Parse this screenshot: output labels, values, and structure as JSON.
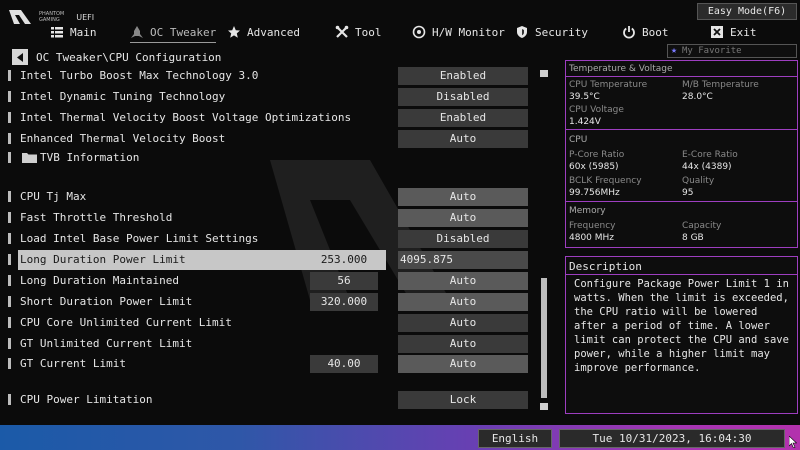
{
  "header": {
    "brand_line1": "PHANTOM",
    "brand_line2": "GAMING",
    "brand_uefi": "UEFI",
    "easy_mode_label": "Easy Mode(F6)",
    "tabs": [
      {
        "label": "Main",
        "icon": "list-icon"
      },
      {
        "label": "OC Tweaker",
        "icon": "rocket-icon",
        "active": true
      },
      {
        "label": "Advanced",
        "icon": "star-icon"
      },
      {
        "label": "Tool",
        "icon": "tools-icon"
      },
      {
        "label": "H/W Monitor",
        "icon": "monitor-icon"
      },
      {
        "label": "Security",
        "icon": "shield-icon"
      },
      {
        "label": "Boot",
        "icon": "power-icon"
      },
      {
        "label": "Exit",
        "icon": "exit-icon"
      }
    ]
  },
  "breadcrumb": "OC Tweaker\\CPU Configuration",
  "favorite_label": "My Favorite",
  "settings": [
    {
      "label": "Intel Turbo Boost Max Technology 3.0",
      "value": "Enabled"
    },
    {
      "label": "Intel Dynamic Tuning Technology",
      "value": "Disabled"
    },
    {
      "label": "Intel Thermal Velocity Boost Voltage Optimizations",
      "value": "Enabled"
    },
    {
      "label": "Enhanced Thermal Velocity Boost",
      "value": "Auto"
    },
    {
      "label": "TVB Information"
    },
    {
      "label": "CPU Tj Max",
      "value": "Auto"
    },
    {
      "label": "Fast Throttle Threshold",
      "value": "Auto"
    },
    {
      "label": "Load Intel Base Power Limit Settings",
      "value": "Disabled"
    },
    {
      "label": "Long Duration Power Limit",
      "number": "253.000",
      "input": "4095.875"
    },
    {
      "label": "Long Duration Maintained",
      "number": "56",
      "value": "Auto"
    },
    {
      "label": "Short Duration Power Limit",
      "number": "320.000",
      "value": "Auto"
    },
    {
      "label": "CPU Core Unlimited Current Limit",
      "value": "Auto"
    },
    {
      "label": "GT Unlimited Current Limit",
      "value": "Auto"
    },
    {
      "label": "GT Current Limit",
      "number": "40.00",
      "value": "Auto"
    },
    {
      "label": "CPU Power Limitation",
      "value": "Lock"
    }
  ],
  "info": {
    "tv_title": "Temperature & Voltage",
    "cpu_temp_label": "CPU Temperature",
    "cpu_temp": "39.5°C",
    "mb_temp_label": "M/B Temperature",
    "mb_temp": "28.0°C",
    "cpu_volt_label": "CPU Voltage",
    "cpu_volt": "1.424V",
    "cpu_title": "CPU",
    "pcore_label": "P-Core Ratio",
    "pcore": "60x (5985)",
    "ecore_label": "E-Core Ratio",
    "ecore": "44x (4389)",
    "bclk_label": "BCLK Frequency",
    "bclk": "99.756MHz",
    "quality_label": "Quality",
    "quality": "95",
    "mem_title": "Memory",
    "freq_label": "Frequency",
    "freq": "4800 MHz",
    "cap_label": "Capacity",
    "cap": "8 GB"
  },
  "description": {
    "title": "Description",
    "text": "Configure Package Power Limit 1 in watts. When the limit is exceeded, the CPU ratio will be lowered after a period of time. A lower limit can protect the CPU and save power, while a higher limit may improve performance."
  },
  "footer": {
    "language": "English",
    "datetime": "Tue 10/31/2023, 16:04:30"
  },
  "colors": {
    "accent_border": "#9d3ec0",
    "bottom_gradient_start": "#1b5aa8",
    "bottom_gradient_end": "#b332ad"
  }
}
